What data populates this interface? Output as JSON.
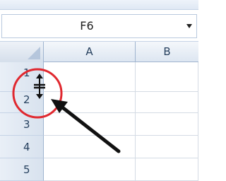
{
  "name_box": {
    "value": "F6"
  },
  "columns": [
    "A",
    "B"
  ],
  "rows": [
    "1",
    "2",
    "3",
    "4",
    "5"
  ],
  "colors": {
    "highlight_circle": "#e0282f",
    "pointer_arrow": "#111111"
  },
  "icons": {
    "resize_cursor": "row-resize-cursor-icon",
    "arrow": "pointer-arrow-icon",
    "dropdown": "chevron-down-icon"
  }
}
